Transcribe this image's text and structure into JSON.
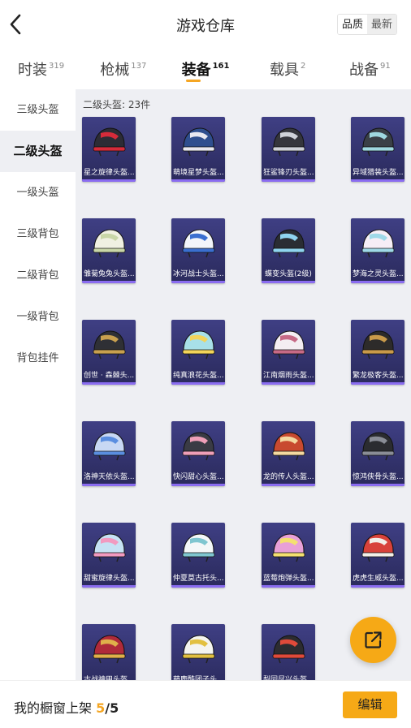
{
  "header": {
    "title": "游戏仓库",
    "sort_quality": "品质",
    "sort_newest": "最新"
  },
  "tabs": [
    {
      "label": "时装",
      "count": "319",
      "active": false
    },
    {
      "label": "枪械",
      "count": "137",
      "active": false
    },
    {
      "label": "装备",
      "count": "161",
      "active": true
    },
    {
      "label": "载具",
      "count": "2",
      "active": false
    },
    {
      "label": "战备",
      "count": "91",
      "active": false
    }
  ],
  "sidebar": {
    "items": [
      {
        "label": "三级头盔",
        "active": false
      },
      {
        "label": "二级头盔",
        "active": true
      },
      {
        "label": "一级头盔",
        "active": false
      },
      {
        "label": "三级背包",
        "active": false
      },
      {
        "label": "二级背包",
        "active": false
      },
      {
        "label": "一级背包",
        "active": false
      },
      {
        "label": "背包挂件",
        "active": false
      }
    ]
  },
  "main": {
    "count_text": "二级头盔: 23件",
    "items": [
      {
        "name": "星之旋律头盔...",
        "shell": "#2c2c35",
        "accent": "#d52b3a"
      },
      {
        "name": "萌境星梦头盔...",
        "shell": "#2f4f8f",
        "accent": "#e8e8f0"
      },
      {
        "name": "狂鲨锋刃头盔...",
        "shell": "#35363c",
        "accent": "#cfd2d8"
      },
      {
        "name": "异域猎装头盔...",
        "shell": "#3a4047",
        "accent": "#9fd8e0"
      },
      {
        "name": "雏菊兔兔头盔...",
        "shell": "#f0f0e2",
        "accent": "#c9d6a8"
      },
      {
        "name": "冰河战士头盔...",
        "shell": "#f2f5fa",
        "accent": "#3a6fd0"
      },
      {
        "name": "蝶变头盔(2级)",
        "shell": "#2a2d33",
        "accent": "#8fd4ef"
      },
      {
        "name": "梦海之灵头盔...",
        "shell": "#f6eef6",
        "accent": "#9fd9e8"
      },
      {
        "name": "创世 · 森棘头...",
        "shell": "#2f3035",
        "accent": "#c8a04f"
      },
      {
        "name": "纯真浪花头盔...",
        "shell": "#a8e0e8",
        "accent": "#f2d45a"
      },
      {
        "name": "江南烟雨头盔...",
        "shell": "#f4eef2",
        "accent": "#c76a86"
      },
      {
        "name": "繁龙极客头盔...",
        "shell": "#2d2b2a",
        "accent": "#c99a4a"
      },
      {
        "name": "洛神天依头盔...",
        "shell": "#c8d8f4",
        "accent": "#5a8ee0"
      },
      {
        "name": "快闪甜心头盔...",
        "shell": "#3a3b44",
        "accent": "#ef9fb8"
      },
      {
        "name": "龙的传人头盔...",
        "shell": "#c84a2f",
        "accent": "#f4d9a0"
      },
      {
        "name": "惊鸿侠骨头盔...",
        "shell": "#2b2c30",
        "accent": "#8a8d96"
      },
      {
        "name": "甜蜜旋律头盔...",
        "shell": "#c6e2f4",
        "accent": "#f29ac0"
      },
      {
        "name": "仲夏莫古托头...",
        "shell": "#f4f7f8",
        "accent": "#7fc6d0"
      },
      {
        "name": "蓝莓炮弹头盔...",
        "shell": "#e8a0d8",
        "accent": "#f4e070"
      },
      {
        "name": "虎虎生威头盔...",
        "shell": "#d8423a",
        "accent": "#f2efe8"
      },
      {
        "name": "古战神甲头盔...",
        "shell": "#b02a3a",
        "accent": "#e0b04a"
      },
      {
        "name": "萌鹿酷团子头...",
        "shell": "#f4f4f0",
        "accent": "#e2c040"
      },
      {
        "name": "梨园尽兴头盔...",
        "shell": "#2c2c30",
        "accent": "#e04a3a"
      }
    ]
  },
  "footer": {
    "label": "我的橱窗上架",
    "current": "5",
    "total": "/5",
    "edit_label": "编辑"
  },
  "icons": {
    "back": "back-arrow-icon",
    "share": "share-external-icon"
  },
  "colors": {
    "accent": "#f6a916",
    "card_bg": "#3a3a7c",
    "card_bar": "#8a6cf0"
  }
}
